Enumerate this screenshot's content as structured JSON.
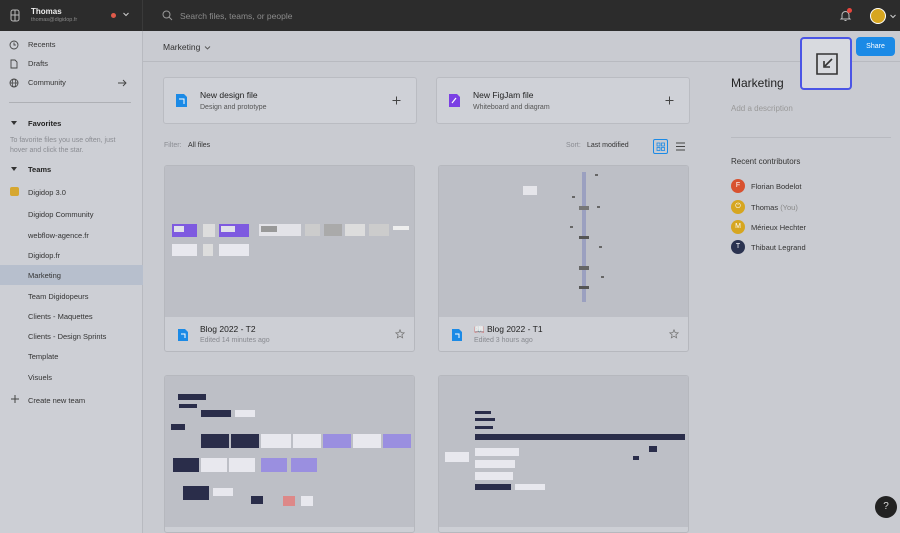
{
  "topbar": {
    "user_name": "Thomas",
    "user_email": "thomas@digidop.fr",
    "search_placeholder": "Search files, teams, or people"
  },
  "sidebar": {
    "nav": [
      {
        "label": "Recents",
        "icon": "clock-icon"
      },
      {
        "label": "Drafts",
        "icon": "file-icon"
      },
      {
        "label": "Community",
        "icon": "globe-icon"
      }
    ],
    "favorites_heading": "Favorites",
    "favorites_hint": "To favorite files you use often, just hover and click the star.",
    "teams_heading": "Teams",
    "teams": [
      {
        "label": "Digidop 3.0"
      },
      {
        "label": "Digidop Community"
      },
      {
        "label": "webflow-agence.fr"
      },
      {
        "label": "Digidop.fr"
      },
      {
        "label": "Marketing"
      },
      {
        "label": "Team Digidopeurs"
      },
      {
        "label": "Clients - Maquettes"
      },
      {
        "label": "Clients - Design Sprints"
      },
      {
        "label": "Template"
      },
      {
        "label": "Visuels"
      }
    ],
    "create_team": "Create new team"
  },
  "main": {
    "breadcrumb": "Marketing",
    "share_label": "Share",
    "new_cards": [
      {
        "title": "New design file",
        "subtitle": "Design and prototype"
      },
      {
        "title": "New FigJam file",
        "subtitle": "Whiteboard and diagram"
      }
    ],
    "filter_label": "Filter:",
    "filter_value": "All files",
    "sort_label": "Sort:",
    "sort_value": "Last modified",
    "files": [
      {
        "name": "Blog 2022 - T2",
        "edited": "Edited 14 minutes ago"
      },
      {
        "name": "📖 Blog 2022 - T1",
        "edited": "Edited 3 hours ago"
      },
      {
        "name": "",
        "edited": ""
      },
      {
        "name": "",
        "edited": ""
      }
    ]
  },
  "right_panel": {
    "title": "Marketing",
    "description_placeholder": "Add a description",
    "contributors_heading": "Recent contributors",
    "contributors": [
      {
        "name": "Florian Bodelot",
        "initial": "F",
        "color": "#d8512f",
        "suffix": ""
      },
      {
        "name": "Thomas",
        "initial": "⏻",
        "color": "#d6a620",
        "suffix": "(You)"
      },
      {
        "name": "Mérieux Hechter",
        "initial": "M",
        "color": "#d6a620",
        "suffix": ""
      },
      {
        "name": "Thibaut Legrand",
        "initial": "T",
        "color": "#2b3350",
        "suffix": ""
      }
    ]
  },
  "help_label": "?",
  "colors": {
    "accent": "#1b8ae6",
    "highlight": "#4b55e6",
    "figjam": "#7b3fe4"
  }
}
